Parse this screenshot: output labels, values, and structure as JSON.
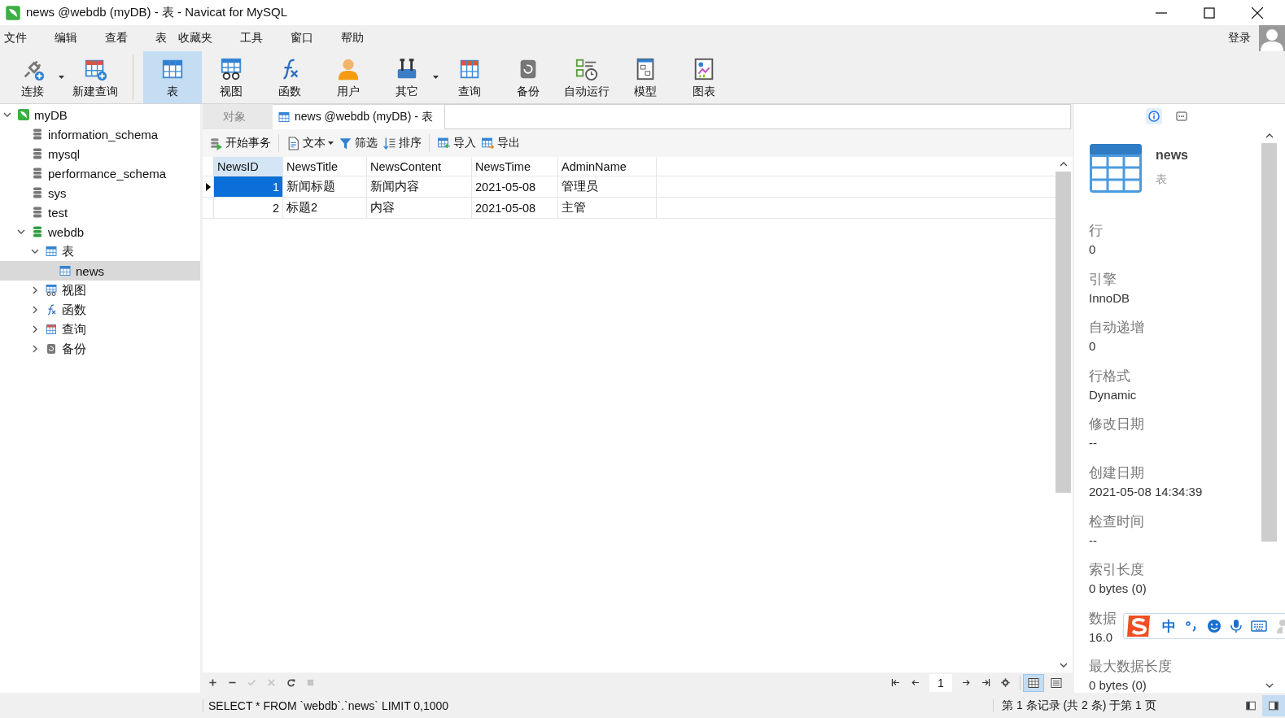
{
  "window": {
    "title": "news @webdb (myDB) - 表 - Navicat for MySQL"
  },
  "menu": {
    "items": [
      "文件",
      "编辑",
      "查看",
      "表",
      "收藏夹",
      "工具",
      "窗口",
      "帮助"
    ],
    "login": "登录"
  },
  "toolbar": [
    {
      "items": [
        {
          "label": "连接",
          "kind": "connect",
          "selected": false,
          "dropdown": true
        },
        {
          "label": "新建查询",
          "kind": "new-query",
          "selected": false,
          "dropdown": false
        }
      ]
    },
    {
      "items": [
        {
          "label": "表",
          "kind": "table",
          "selected": true,
          "dropdown": false
        },
        {
          "label": "视图",
          "kind": "view",
          "selected": false,
          "dropdown": false
        },
        {
          "label": "函数",
          "kind": "function",
          "selected": false,
          "dropdown": false
        },
        {
          "label": "用户",
          "kind": "user",
          "selected": false,
          "dropdown": false
        },
        {
          "label": "其它",
          "kind": "other",
          "selected": false,
          "dropdown": true
        },
        {
          "label": "查询",
          "kind": "query",
          "selected": false,
          "dropdown": false
        },
        {
          "label": "备份",
          "kind": "backup",
          "selected": false,
          "dropdown": false
        },
        {
          "label": "自动运行",
          "kind": "automation",
          "selected": false,
          "dropdown": false
        },
        {
          "label": "模型",
          "kind": "model",
          "selected": false,
          "dropdown": false
        },
        {
          "label": "图表",
          "kind": "chart",
          "selected": false,
          "dropdown": false
        }
      ]
    }
  ],
  "tree": [
    {
      "label": "myDB",
      "kind": "connection",
      "expanded": true,
      "selected": false,
      "children": [
        {
          "label": "information_schema",
          "kind": "database",
          "opened": false,
          "selected": false
        },
        {
          "label": "mysql",
          "kind": "database",
          "opened": false,
          "selected": false
        },
        {
          "label": "performance_schema",
          "kind": "database",
          "opened": false,
          "selected": false
        },
        {
          "label": "sys",
          "kind": "database",
          "opened": false,
          "selected": false
        },
        {
          "label": "test",
          "kind": "database",
          "opened": false,
          "selected": false
        },
        {
          "label": "webdb",
          "kind": "database",
          "opened": true,
          "expanded": true,
          "selected": false,
          "children": [
            {
              "label": "表",
              "kind": "table",
              "expanded": true,
              "selected": false,
              "children": [
                {
                  "label": "news",
                  "kind": "table",
                  "selected": true
                }
              ]
            },
            {
              "label": "视图",
              "kind": "view",
              "expanded": false,
              "selected": false
            },
            {
              "label": "函数",
              "kind": "function",
              "expanded": false,
              "selected": false
            },
            {
              "label": "查询",
              "kind": "query",
              "expanded": false,
              "selected": false
            },
            {
              "label": "备份",
              "kind": "backup",
              "expanded": false,
              "selected": false
            }
          ]
        }
      ]
    }
  ],
  "tabs": [
    {
      "label": "对象",
      "selected": false,
      "icon": false
    },
    {
      "label": "news @webdb (myDB) - 表",
      "selected": true,
      "icon": true
    }
  ],
  "object_toolbar": [
    {
      "items": [
        {
          "label": "开始事务",
          "kind": "transaction",
          "dropdown": false
        }
      ]
    },
    {
      "items": [
        {
          "label": "文本",
          "kind": "text",
          "dropdown": true
        },
        {
          "label": "筛选",
          "kind": "filter",
          "dropdown": false
        },
        {
          "label": "排序",
          "kind": "sort",
          "dropdown": false
        }
      ]
    },
    {
      "items": [
        {
          "label": "导入",
          "kind": "import",
          "dropdown": false
        },
        {
          "label": "导出",
          "kind": "export",
          "dropdown": false
        }
      ]
    }
  ],
  "table": {
    "columns": [
      {
        "name": "NewsID",
        "selected": true
      },
      {
        "name": "NewsTitle",
        "selected": false
      },
      {
        "name": "NewsContent",
        "selected": false
      },
      {
        "name": "NewsTime",
        "selected": false
      },
      {
        "name": "AdminName",
        "selected": false
      }
    ],
    "rows": [
      {
        "current": true,
        "cells": [
          "1",
          "新闻标题",
          "新闻内容",
          "2021-05-08",
          "管理员"
        ]
      },
      {
        "current": false,
        "cells": [
          "2",
          "标题2",
          "内容",
          "2021-05-08",
          "主管"
        ]
      }
    ]
  },
  "record_actions": [
    {
      "kind": "add",
      "disabled": false
    },
    {
      "kind": "delete",
      "disabled": false
    },
    {
      "kind": "apply",
      "disabled": true
    },
    {
      "kind": "cancel",
      "disabled": true
    },
    {
      "kind": "refresh",
      "disabled": false
    },
    {
      "kind": "stop",
      "disabled": true
    }
  ],
  "pager": {
    "page": "1"
  },
  "view_modes": [
    {
      "kind": "grid",
      "selected": true
    },
    {
      "kind": "form",
      "selected": false
    }
  ],
  "info_panel": {
    "tabs": [
      {
        "kind": "info",
        "selected": true
      },
      {
        "kind": "ddl",
        "selected": false
      }
    ],
    "name": "news",
    "type": "表",
    "properties": [
      {
        "label": "行",
        "value": "0"
      },
      {
        "label": "引擎",
        "value": "InnoDB"
      },
      {
        "label": "自动递增",
        "value": "0"
      },
      {
        "label": "行格式",
        "value": "Dynamic"
      },
      {
        "label": "修改日期",
        "value": "--"
      },
      {
        "label": "创建日期",
        "value": "2021-05-08 14:34:39"
      },
      {
        "label": "检查时间",
        "value": "--"
      },
      {
        "label": "索引长度",
        "value": "0 bytes (0)"
      },
      {
        "label": "数据",
        "value": "16.0"
      },
      {
        "label": "最大数据长度",
        "value": "0 bytes (0)"
      }
    ]
  },
  "ime_bar": {
    "mode": "中"
  },
  "status_bar": {
    "sql": "SELECT * FROM `webdb`.`news` LIMIT 0,1000",
    "records": "第 1 条记录 (共 2 条) 于第 1 页",
    "panes": [
      {
        "kind": "left",
        "selected": false
      },
      {
        "kind": "right",
        "selected": true
      }
    ]
  }
}
